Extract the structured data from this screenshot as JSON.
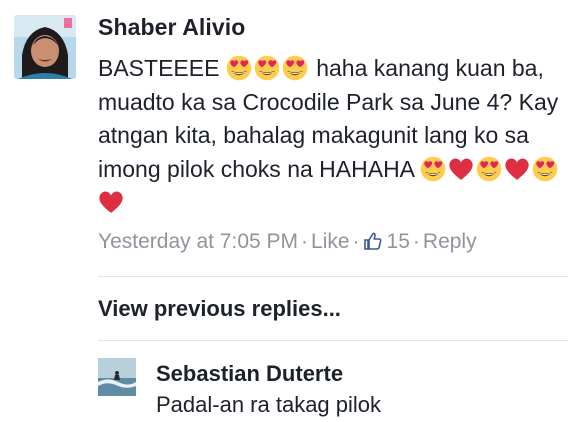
{
  "comment": {
    "author": "Shaber Alivio",
    "text_part1": "BASTEEEE",
    "text_part2": " haha kanang kuan ba, muadto ka sa Crocodile Park sa June 4? Kay atngan kita, bahalag makagunit lang ko sa imong pilok choks na HAHAHA",
    "emojis_inline": [
      "heart-eyes-emoji",
      "heart-eyes-emoji",
      "heart-eyes-emoji"
    ],
    "emojis_trailing": [
      "heart-eyes-emoji",
      "red-heart-emoji",
      "heart-eyes-emoji",
      "red-heart-emoji",
      "heart-eyes-emoji",
      "red-heart-emoji"
    ],
    "meta": {
      "time": "Yesterday at 7:05 PM",
      "like_label": "Like",
      "like_count": "15",
      "reply_label": "Reply",
      "separator": "·"
    }
  },
  "view_previous": "View previous replies...",
  "reply": {
    "author": "Sebastian Duterte",
    "text": "Padal-an ra takag pilok"
  },
  "colors": {
    "text": "#1d2129",
    "meta": "#90949c",
    "divider": "#e5e6e9",
    "emoji_face": "#ffcc4d",
    "heart": "#dd2e44"
  }
}
